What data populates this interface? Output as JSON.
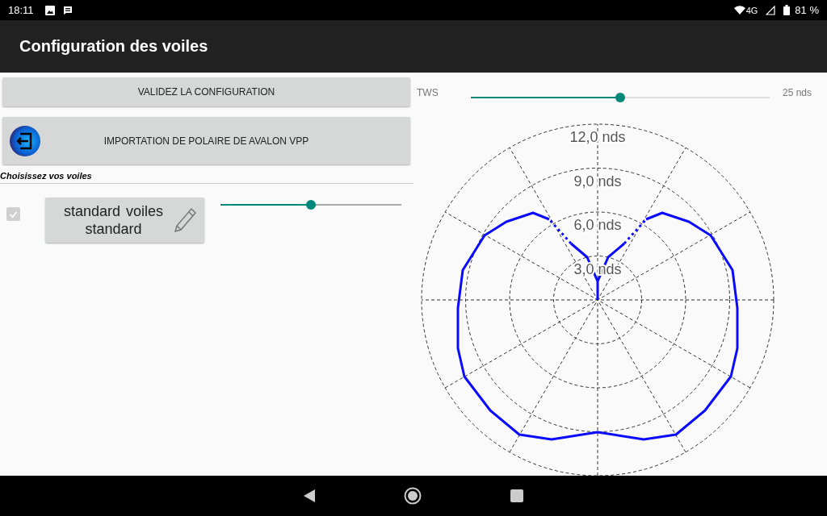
{
  "status_bar": {
    "time": "18:11",
    "network": "4G",
    "battery": "81 %"
  },
  "app_bar": {
    "title": "Configuration des voiles"
  },
  "left_panel": {
    "validate_button": "VALIDEZ LA CONFIGURATION",
    "import_button": "IMPORTATION DE POLAIRE DE AVALON VPP",
    "section_label": "Choisissez vos voiles",
    "sails": [
      {
        "name": "standard  voiles standard",
        "checked": true,
        "disabled": true,
        "level": 0.5
      }
    ]
  },
  "tws": {
    "label": "TWS",
    "level": 0.5,
    "reading": "25 nds"
  },
  "polar": {
    "rings": [
      "12,0 nds",
      "9,0 nds",
      "6,0 nds",
      "3,0 nds"
    ]
  }
}
